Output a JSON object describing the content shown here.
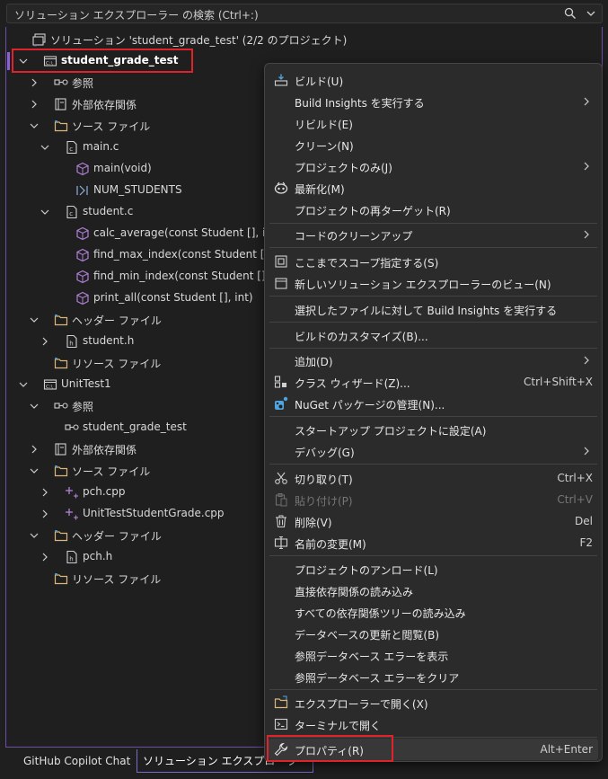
{
  "search": {
    "placeholder": "ソリューション エクスプローラー の検索 (Ctrl+:)"
  },
  "tree": {
    "solution_label": "ソリューション 'student_grade_test' (2/2 のプロジェクト)",
    "items": [
      {
        "label": "student_grade_test"
      },
      {
        "label": "参照"
      },
      {
        "label": "外部依存関係"
      },
      {
        "label": "ソース ファイル"
      },
      {
        "label": "main.c"
      },
      {
        "label": "main(void)"
      },
      {
        "label": "NUM_STUDENTS"
      },
      {
        "label": "student.c"
      },
      {
        "label": "calc_average(const Student [], int)"
      },
      {
        "label": "find_max_index(const Student [], int)"
      },
      {
        "label": "find_min_index(const Student [], int)"
      },
      {
        "label": "print_all(const Student [], int)"
      },
      {
        "label": "ヘッダー ファイル"
      },
      {
        "label": "student.h"
      },
      {
        "label": "リソース ファイル"
      },
      {
        "label": "UnitTest1"
      },
      {
        "label": "参照"
      },
      {
        "label": "student_grade_test"
      },
      {
        "label": "外部依存関係"
      },
      {
        "label": "ソース ファイル"
      },
      {
        "label": "pch.cpp"
      },
      {
        "label": "UnitTestStudentGrade.cpp"
      },
      {
        "label": "ヘッダー ファイル"
      },
      {
        "label": "pch.h"
      },
      {
        "label": "リソース ファイル"
      }
    ]
  },
  "tabs": [
    {
      "label": "GitHub Copilot Chat"
    },
    {
      "label": "ソリューション エクスプローラー"
    }
  ],
  "menu": {
    "items": [
      {
        "label": "ビルド(U)",
        "shortcut": ""
      },
      {
        "label": "Build Insights を実行する",
        "shortcut": ""
      },
      {
        "label": "リビルド(E)",
        "shortcut": ""
      },
      {
        "label": "クリーン(N)",
        "shortcut": ""
      },
      {
        "label": "プロジェクトのみ(J)",
        "shortcut": ""
      },
      {
        "label": "最新化(M)",
        "shortcut": ""
      },
      {
        "label": "プロジェクトの再ターゲット(R)",
        "shortcut": ""
      },
      {
        "label": "コードのクリーンアップ",
        "shortcut": ""
      },
      {
        "label": "ここまでスコープ指定する(S)",
        "shortcut": ""
      },
      {
        "label": "新しいソリューション エクスプローラーのビュー(N)",
        "shortcut": ""
      },
      {
        "label": "選択したファイルに対して Build Insights を実行する",
        "shortcut": ""
      },
      {
        "label": "ビルドのカスタマイズ(B)...",
        "shortcut": ""
      },
      {
        "label": "追加(D)",
        "shortcut": ""
      },
      {
        "label": "クラス ウィザード(Z)...",
        "shortcut": "Ctrl+Shift+X"
      },
      {
        "label": "NuGet パッケージの管理(N)...",
        "shortcut": ""
      },
      {
        "label": "スタートアップ プロジェクトに設定(A)",
        "shortcut": ""
      },
      {
        "label": "デバッグ(G)",
        "shortcut": ""
      },
      {
        "label": "切り取り(T)",
        "shortcut": "Ctrl+X"
      },
      {
        "label": "貼り付け(P)",
        "shortcut": "Ctrl+V"
      },
      {
        "label": "削除(V)",
        "shortcut": "Del"
      },
      {
        "label": "名前の変更(M)",
        "shortcut": "F2"
      },
      {
        "label": "プロジェクトのアンロード(L)",
        "shortcut": ""
      },
      {
        "label": "直接依存関係の読み込み",
        "shortcut": ""
      },
      {
        "label": "すべての依存関係ツリーの読み込み",
        "shortcut": ""
      },
      {
        "label": "データベースの更新と閲覧(B)",
        "shortcut": ""
      },
      {
        "label": "参照データベース エラーを表示",
        "shortcut": ""
      },
      {
        "label": "参照データベース エラーをクリア",
        "shortcut": ""
      },
      {
        "label": "エクスプローラーで開く(X)",
        "shortcut": ""
      },
      {
        "label": "ターミナルで開く",
        "shortcut": ""
      },
      {
        "label": "プロパティ(R)",
        "shortcut": "Alt+Enter"
      }
    ]
  },
  "colors": {
    "background": "#1f1f1f",
    "menu_bg": "#2b2b2b",
    "highlight_red": "#e0222a",
    "accent_purple": "#8a63d2",
    "folder_yellow": "#dcb67a",
    "function_purple": "#b180d7"
  }
}
